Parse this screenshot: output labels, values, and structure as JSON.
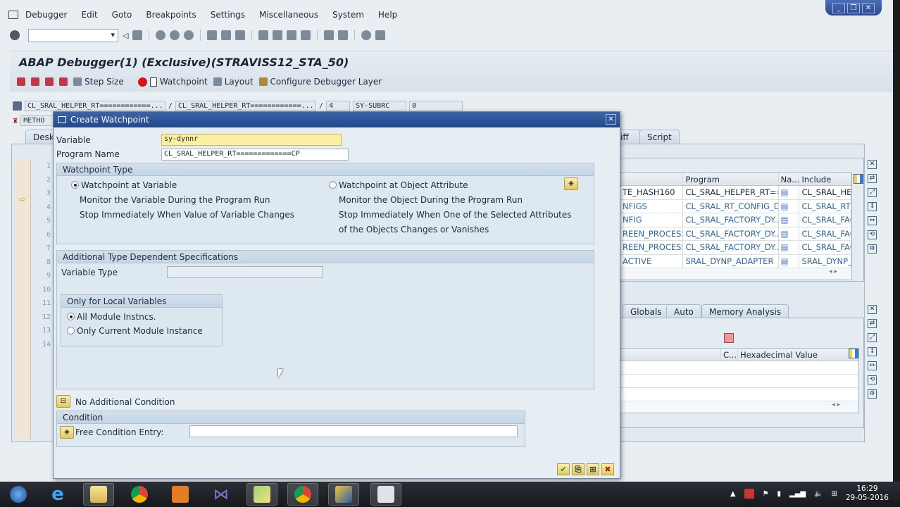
{
  "menu": {
    "items": [
      "Debugger",
      "Edit",
      "Goto",
      "Breakpoints",
      "Settings",
      "Miscellaneous",
      "System",
      "Help"
    ]
  },
  "window_controls": {
    "minimize": "_",
    "restore": "❐",
    "close": "✕"
  },
  "header": {
    "title": "ABAP Debugger(1)  (Exclusive)(STRAVISS12_STA_50)",
    "toolbar": {
      "step_size": "Step Size",
      "watchpoint": "Watchpoint",
      "layout": "Layout",
      "configure": "Configure Debugger Layer"
    }
  },
  "context_fields": {
    "program": "CL_SRAL_HELPER_RT============...",
    "include": "CL_SRAL_HELPER_RT============...",
    "line": "4",
    "sysfield": "SY-SUBRC",
    "sysvalue": "0",
    "method_prefix": "METHO"
  },
  "background_tabs": {
    "desktop": "Deskt",
    "diff": "iff",
    "script": "Script"
  },
  "line_numbers": [
    "1",
    "2",
    "3",
    "4",
    "5",
    "6",
    "7",
    "8",
    "9",
    "10",
    "11",
    "12",
    "13",
    "14"
  ],
  "stack_grid": {
    "columns": [
      "Program",
      "Na...",
      "Include"
    ],
    "rows": [
      {
        "event": "TE_HASH160",
        "program": "CL_SRAL_HELPER_RT==...",
        "include": "CL_SRAL_HEL"
      },
      {
        "event": "NFIGS",
        "program": "CL_SRAL_RT_CONFIG_D...",
        "include": "CL_SRAL_RT_"
      },
      {
        "event": "NFIG",
        "program": "CL_SRAL_FACTORY_DY...",
        "include": "CL_SRAL_FAC"
      },
      {
        "event": "REEN_PROCESS...",
        "program": "CL_SRAL_FACTORY_DY...",
        "include": "CL_SRAL_FAC"
      },
      {
        "event": "REEN_PROCESS...",
        "program": "CL_SRAL_FACTORY_DY...",
        "include": "CL_SRAL_FAC"
      },
      {
        "event": "ACTIVE",
        "program": "SRAL_DYNP_ADAPTER",
        "include": "SRAL_DYNP_A"
      }
    ]
  },
  "var_tabs": [
    "Globals",
    "Auto",
    "Memory Analysis"
  ],
  "var_grid": {
    "columns": [
      "C...",
      "Hexadecimal Value"
    ]
  },
  "dialog": {
    "title": "Create Watchpoint",
    "variable_label": "Variable",
    "variable_value": "sy-dynnr",
    "program_label": "Program Name",
    "program_value": "CL_SRAL_HELPER_RT=============CP",
    "watchpoint_type": {
      "heading": "Watchpoint Type",
      "option_variable": "Watchpoint at Variable",
      "variable_desc1": "Monitor the Variable During the Program Run",
      "variable_desc2": "Stop Immediately When Value of Variable Changes",
      "option_object": "Watchpoint at Object Attribute",
      "object_desc1": "Monitor the Object During the Program Run",
      "object_desc2": "Stop Immediately When One of the Selected Attributes",
      "object_desc3": "of the Objects Changes or Vanishes",
      "selected": "variable"
    },
    "additional": {
      "heading": "Additional Type Dependent Specifications",
      "variable_type_label": "Variable Type",
      "variable_type_value": ""
    },
    "local_vars": {
      "heading": "Only for Local Variables",
      "option_all": "All Module Instncs.",
      "option_current": "Only Current Module Instance",
      "selected": "all"
    },
    "no_condition": "No Additional Condition",
    "condition": {
      "heading": "Condition",
      "free_label": "Free Condition Entry:",
      "free_value": ""
    }
  },
  "taskbar": {
    "time": "16:29",
    "date": "29-05-2016"
  }
}
